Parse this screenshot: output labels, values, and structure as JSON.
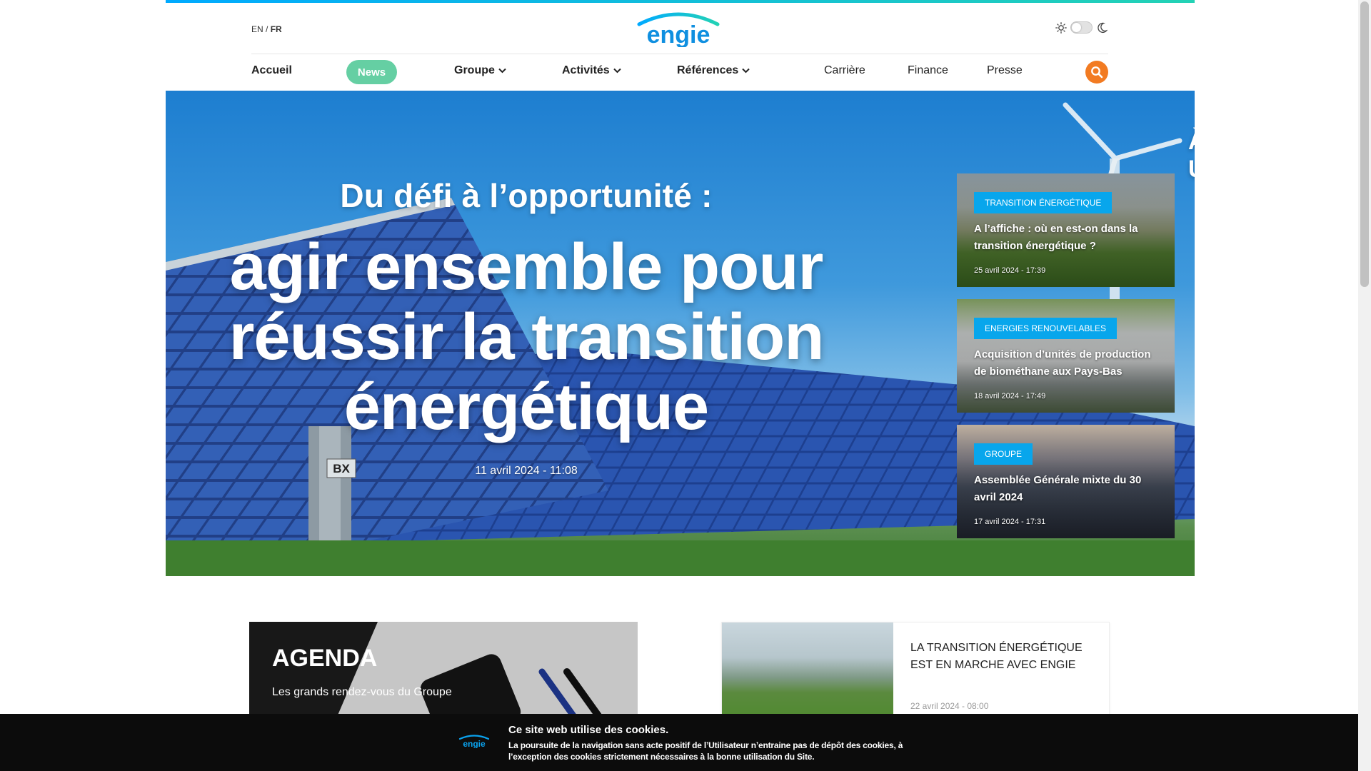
{
  "colors": {
    "accent_start": "#00aaff",
    "accent_end": "#23d2b5",
    "news_pill": "#65cfa3",
    "search": "#f27b22",
    "tag": "#08a6ec"
  },
  "header": {
    "lang_en": "EN",
    "lang_sep": " / ",
    "lang_fr": "FR",
    "logo_text": "engie",
    "theme_light_icon": "sun-icon",
    "theme_dark_icon": "moon-icon"
  },
  "nav": {
    "accueil": "Accueil",
    "news": "News",
    "groupe": "Groupe",
    "activites": "Activités",
    "references": "Références",
    "carriere": "Carrière",
    "finance": "Finance",
    "presse": "Presse",
    "search_icon": "search-icon"
  },
  "hero": {
    "kicker": "Du défi à l’opportunité :",
    "title": "agir ensemble pour réussir la transition énergétique",
    "date": "11 avril 2024 - 11:08",
    "label_bx": "BX",
    "une_title": "À la Une"
  },
  "une_cards": [
    {
      "tag": "Transition énergétique",
      "title": "A l’affiche : où en est-on dans la transition énergétique ?",
      "date": "25 avril 2024 - 17:39"
    },
    {
      "tag": "Energies renouvelables",
      "title": "Acquisition d’unités de production de biométhane aux Pays-Bas",
      "date": "18 avril 2024 - 17:49"
    },
    {
      "tag": "Groupe",
      "title": "Assemblée Générale mixte du 30 avril 2024",
      "date": "17 avril 2024 - 17:31"
    }
  ],
  "agenda": {
    "title": "AGENDA",
    "subtitle": "Les grands rendez-vous du Groupe"
  },
  "article": {
    "title": "La transition énergétique est en marche avec ENGIE",
    "date": "22 avril 2024 - 08:00"
  },
  "cookie": {
    "logo_text": "engie",
    "title": "Ce site web utilise des cookies.",
    "text": "La poursuite de la navigation sans acte positif de l’Utilisateur n’entraine pas de dépôt des cookies, à l’exception des cookies strictement nécessaires à la bonne utilisation du Site."
  }
}
